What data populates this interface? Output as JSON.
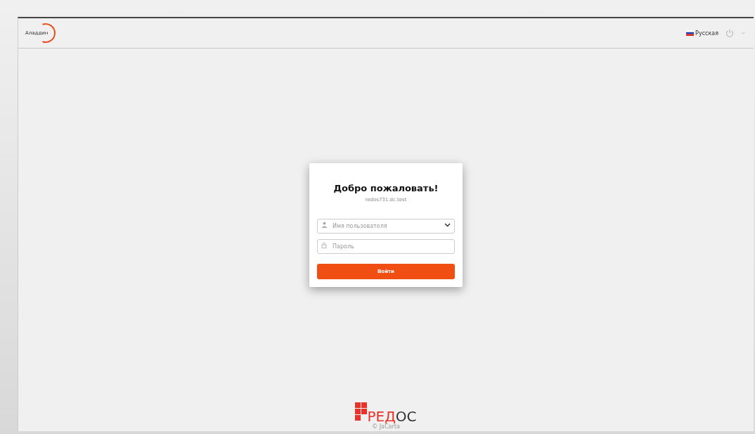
{
  "header": {
    "logo": "Аладдин",
    "language": "Русская"
  },
  "login": {
    "title": "Добро пожаловать!",
    "host": "redos731.dc.test",
    "username": {
      "placeholder": "Имя пользователя"
    },
    "password": {
      "placeholder": "Пароль"
    },
    "submit": "Войти"
  },
  "footer": {
    "brand_prefix": "РЕД",
    "brand_suffix": "ОС",
    "copyright": "© JaCarta"
  }
}
